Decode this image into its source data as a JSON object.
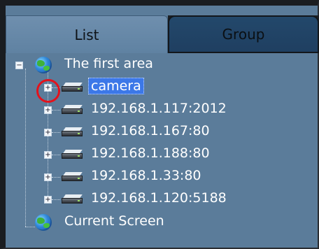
{
  "tabs": [
    {
      "label": "List",
      "active": true
    },
    {
      "label": "Group",
      "active": false
    }
  ],
  "tree": {
    "root": {
      "label": "The first area",
      "expanded": true,
      "icon": "globe-icon"
    },
    "devices": [
      {
        "label": "camera",
        "selected": true,
        "icon": "dvr-icon",
        "expanded": false
      },
      {
        "label": "192.168.1.117:2012",
        "selected": false,
        "icon": "dvr-icon",
        "expanded": false
      },
      {
        "label": "192.168.1.167:80",
        "selected": false,
        "icon": "dvr-icon",
        "expanded": false
      },
      {
        "label": "192.168.1.188:80",
        "selected": false,
        "icon": "dvr-icon",
        "expanded": false
      },
      {
        "label": "192.168.1.33:80",
        "selected": false,
        "icon": "dvr-icon",
        "expanded": false
      },
      {
        "label": "192.168.1.120:5188",
        "selected": false,
        "icon": "dvr-icon",
        "expanded": false
      }
    ],
    "current_screen": {
      "label": "Current Screen",
      "icon": "globe-icon"
    }
  },
  "colors": {
    "panel_bg": "#5b7c9a",
    "selection": "#3c78e8",
    "annotation_ring": "#e3121c"
  }
}
